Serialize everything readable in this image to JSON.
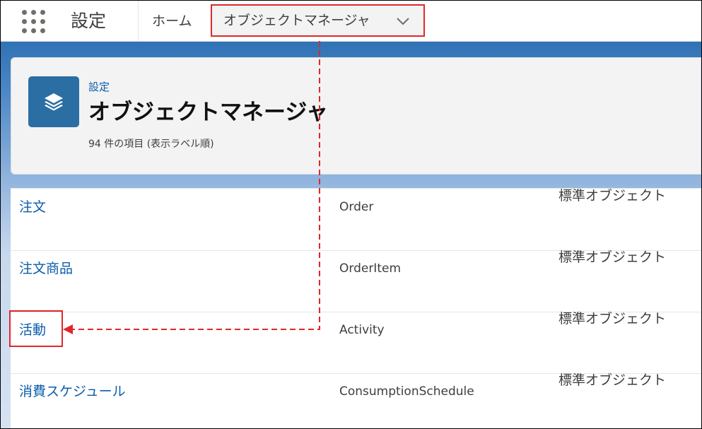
{
  "nav": {
    "app_title": "設定",
    "home_label": "ホーム",
    "active_tab_label": "オブジェクトマネージャ"
  },
  "header": {
    "breadcrumb": "設定",
    "title": "オブジェクトマネージャ",
    "item_count": "94 件の項目 (表示ラベル順)"
  },
  "rows": [
    {
      "label": "注文",
      "api_name": "Order",
      "type": "標準オブジェクト"
    },
    {
      "label": "注文商品",
      "api_name": "OrderItem",
      "type": "標準オブジェクト"
    },
    {
      "label": "活動",
      "api_name": "Activity",
      "type": "標準オブジェクト"
    },
    {
      "label": "消費スケジュール",
      "api_name": "ConsumptionSchedule",
      "type": "標準オブジェクト"
    }
  ],
  "colors": {
    "annotation": "#e0272b",
    "link": "#0b5cab",
    "icon_bg": "#2b6ea4"
  },
  "icons": {
    "launcher": "app-launcher-grid-icon",
    "tab_menu": "chevron-down-icon",
    "header": "layers-stack-icon"
  }
}
